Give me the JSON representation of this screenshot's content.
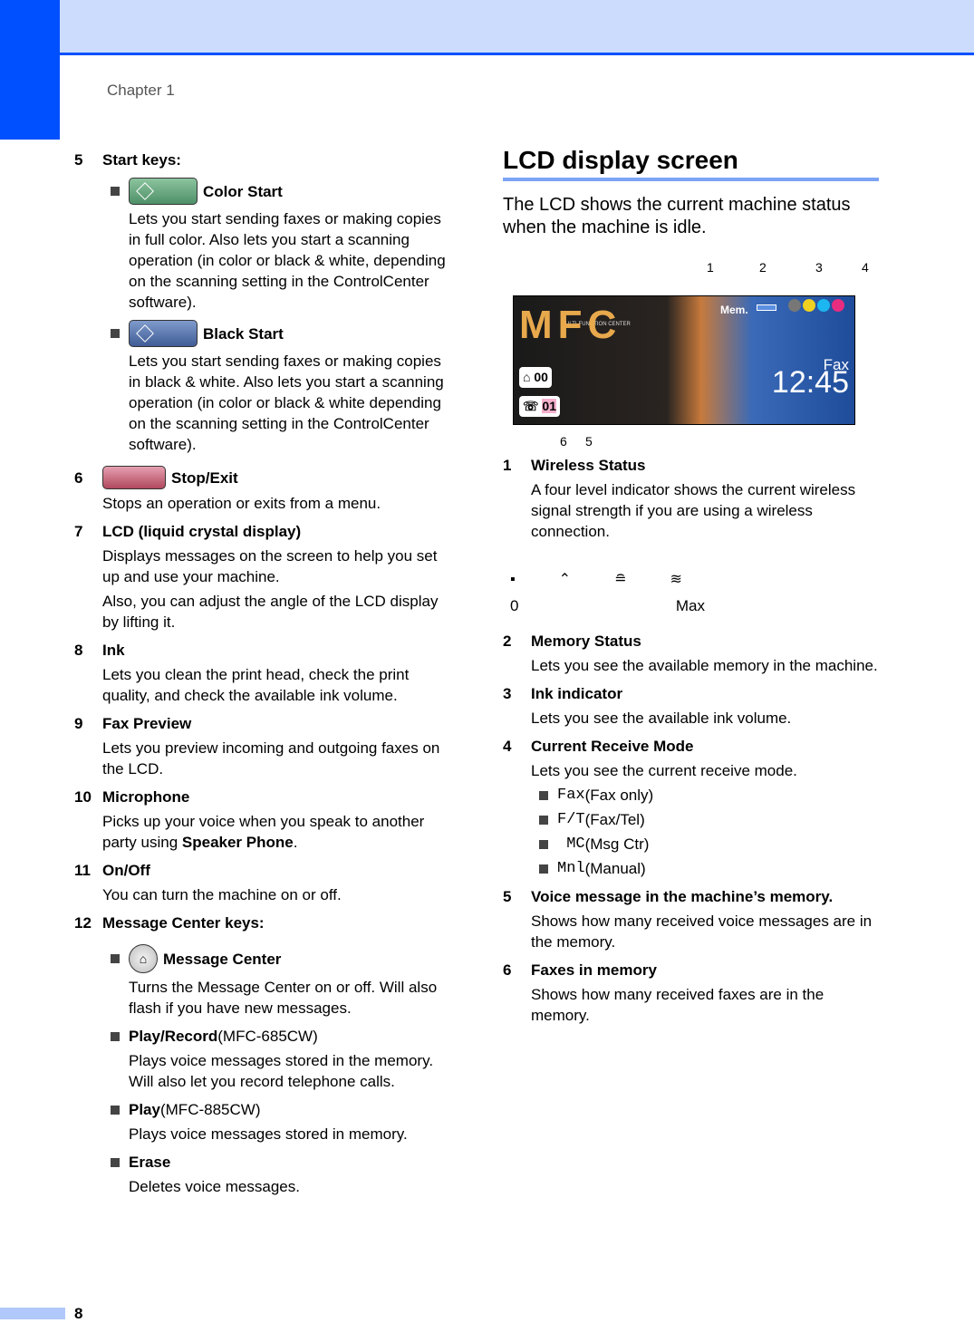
{
  "header": {
    "chapter": "Chapter 1"
  },
  "footer": {
    "page_number": "8"
  },
  "left": {
    "item5": {
      "num": "5",
      "title": "Start keys:",
      "color_start": {
        "label": "Color Start",
        "desc": "Lets you start sending faxes or making copies in full color. Also lets you start a scanning operation (in color or black & white, depending on the scanning setting in the ControlCenter software)."
      },
      "black_start": {
        "label": "Black Start",
        "desc": "Lets you start sending faxes or making copies in black & white. Also lets you start a scanning operation (in color or black & white depending on the scanning setting in the ControlCenter software)."
      }
    },
    "item6": {
      "num": "6",
      "title": "Stop/Exit",
      "desc": "Stops an operation or exits from a menu."
    },
    "item7": {
      "num": "7",
      "title": "LCD (liquid crystal display)",
      "desc1": "Displays messages on the screen to help you set up and use your machine.",
      "desc2": "Also, you can adjust the angle of the LCD display by lifting it."
    },
    "item8": {
      "num": "8",
      "title": "Ink",
      "desc": "Lets you clean the print head, check the print quality, and check the available ink volume."
    },
    "item9": {
      "num": "9",
      "title": "Fax Preview",
      "desc": "Lets you preview incoming and outgoing faxes on the LCD."
    },
    "item10": {
      "num": "10",
      "title": "Microphone",
      "desc_pre": "Picks up your voice when you speak to another party using ",
      "desc_bold": "Speaker Phone",
      "desc_post": "."
    },
    "item11": {
      "num": "11",
      "title": "On/Off",
      "desc": "You can turn the machine on or off."
    },
    "item12": {
      "num": "12",
      "title": "Message Center keys:",
      "msg_center": {
        "label": "Message Center",
        "desc": "Turns the Message Center on or off. Will also flash if you have new messages."
      },
      "play_record": {
        "label": "Play/Record",
        "model": " (MFC-685CW)",
        "desc": "Plays voice messages stored in the memory. Will also let you record telephone calls."
      },
      "play": {
        "label": "Play",
        "model": " (MFC-885CW)",
        "desc": "Plays voice messages stored in memory."
      },
      "erase": {
        "label": "Erase",
        "desc": "Deletes voice messages."
      }
    }
  },
  "right": {
    "title": "LCD display screen",
    "intro": "The LCD shows the current machine status when the machine is idle.",
    "lcd": {
      "callouts": [
        "1",
        "2",
        "3",
        "4",
        "5",
        "6"
      ],
      "logo": "MFC",
      "logo_sub": "MULTI-FUNCTION CENTER",
      "mem": "Mem.",
      "mode": "Fax",
      "time": "12:45",
      "voice_count": "00",
      "fax_count": "01"
    },
    "items": [
      {
        "num": "1",
        "title": "Wireless Status",
        "desc": "A four level indicator shows the current wireless signal strength if you are using a wireless connection."
      },
      {
        "num": "2",
        "title": "Memory Status",
        "desc": "Lets you see the available memory in the machine."
      },
      {
        "num": "3",
        "title": "Ink indicator",
        "desc": "Lets you see the available ink volume."
      },
      {
        "num": "4",
        "title": "Current Receive Mode",
        "desc": "Lets you see the current receive mode."
      },
      {
        "num": "5",
        "title": "Voice message in the machine’s memory.",
        "desc": "Shows how many received voice messages are in the memory."
      },
      {
        "num": "6",
        "title": "Faxes in memory",
        "desc": "Shows how many received faxes are in the memory."
      }
    ],
    "wifi_labels": {
      "min": "0",
      "max": "Max"
    },
    "modes": [
      {
        "code": "Fax",
        "desc": " (Fax only)"
      },
      {
        "code": "F/T",
        "desc": " (Fax/Tel)"
      },
      {
        "code": " MC",
        "desc": " (Msg Ctr)"
      },
      {
        "code": "Mnl",
        "desc": " (Manual)"
      }
    ]
  }
}
